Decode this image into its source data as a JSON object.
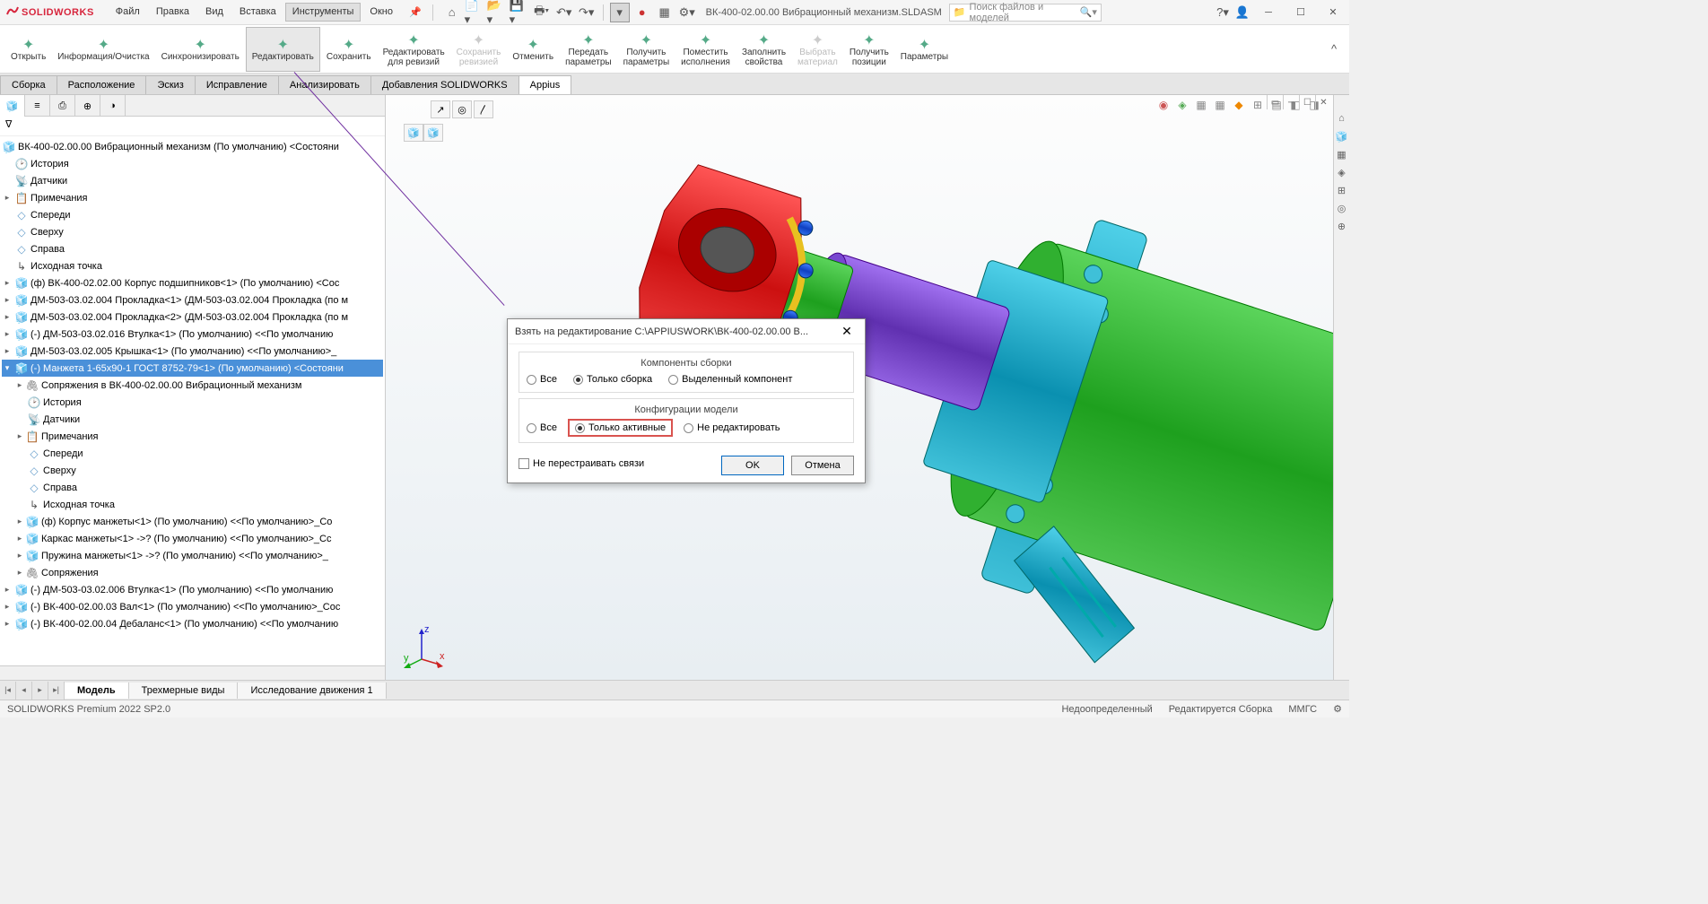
{
  "app": {
    "logo_text": "SOLIDWORKS",
    "doc_title": "ВК-400-02.00.00 Вибрационный механизм.SLDASM",
    "search_placeholder": "Поиск файлов и моделей"
  },
  "menu": {
    "file": "Файл",
    "edit": "Правка",
    "view": "Вид",
    "insert": "Вставка",
    "tools": "Инструменты",
    "window": "Окно"
  },
  "ribbon": {
    "open": "Открыть",
    "info": "Информация/Очистка",
    "sync": "Синхронизировать",
    "editmode": "Редактировать",
    "save": "Сохранить",
    "edit_rev": "Редактировать\nдля ревизий",
    "save_rev": "Сохранить\nревизией",
    "cancel": "Отменить",
    "send_params": "Передать\nпараметры",
    "get_params": "Получить\nпараметры",
    "place_exec": "Поместить\nисполнения",
    "fill_props": "Заполнить\nсвойства",
    "sel_material": "Выбрать\nматериал",
    "get_positions": "Получить\nпозиции",
    "params": "Параметры"
  },
  "tabs": {
    "assembly": "Сборка",
    "layout": "Расположение",
    "sketch": "Эскиз",
    "fix": "Исправление",
    "analyze": "Анализировать",
    "addins": "Добавления SOLIDWORKS",
    "appius": "Appius"
  },
  "tree": {
    "root": "ВК-400-02.00.00 Вибрационный механизм (По умолчанию) <Состояни",
    "history": "История",
    "sensors": "Датчики",
    "notes": "Примечания",
    "front": "Спереди",
    "top": "Сверху",
    "right": "Справа",
    "origin": "Исходная точка",
    "n1": "(ф) ВК-400-02.02.00 Корпус подшипников<1> (По умолчанию) <Сос",
    "n2": "ДМ-503-03.02.004 Прокладка<1> (ДМ-503-03.02.004 Прокладка (по м",
    "n3": "ДМ-503-03.02.004 Прокладка<2> (ДМ-503-03.02.004 Прокладка (по м",
    "n4": "(-) ДМ-503-03.02.016 Втулка<1> (По умолчанию) <<По умолчанию",
    "n5": "ДМ-503-03.02.005 Крышка<1> (По умолчанию) <<По умолчанию>_",
    "n6": "(-) Манжета 1-65х90-1 ГОСТ 8752-79<1> (По умолчанию) <Состояни",
    "n6_mates_in": "Сопряжения в ВК-400-02.00.00 Вибрационный механизм",
    "n6_hist": "История",
    "n6_sens": "Датчики",
    "n6_notes": "Примечания",
    "n6_front": "Спереди",
    "n6_top": "Сверху",
    "n6_right": "Справа",
    "n6_origin": "Исходная точка",
    "n6_c1": "(ф) Корпус манжеты<1> (По умолчанию) <<По умолчанию>_Со",
    "n6_c2": "Каркас манжеты<1> ->? (По умолчанию) <<По умолчанию>_Сс",
    "n6_c3": "Пружина манжеты<1> ->? (По умолчанию) <<По умолчанию>_",
    "n6_mates": "Сопряжения",
    "n7": "(-) ДМ-503-03.02.006 Втулка<1> (По умолчанию) <<По умолчанию",
    "n8": "(-) ВК-400-02.00.03 Вал<1> (По умолчанию) <<По умолчанию>_Сос",
    "n9": "(-) ВК-400-02.00.04 Дебаланс<1> (По умолчанию) <<По умолчанию"
  },
  "dialog": {
    "title": "Взять на редактирование C:\\APPIUSWORK\\ВК-400-02.00.00 В...",
    "group1": "Компоненты сборки",
    "r_all": "Все",
    "r_asm_only": "Только сборка",
    "r_selected": "Выделенный компонент",
    "group2": "Конфигурации модели",
    "r_cfg_all": "Все",
    "r_cfg_active": "Только активные",
    "r_cfg_none": "Не редактировать",
    "chk_norebuild": "Не перестраивать связи",
    "ok": "OK",
    "cancel": "Отмена"
  },
  "bottom_tabs": {
    "model": "Модель",
    "views3d": "Трехмерные виды",
    "motion": "Исследование движения 1"
  },
  "status": {
    "product": "SOLIDWORKS Premium 2022 SP2.0",
    "undef": "Недоопределенный",
    "editing": "Редактируется Сборка",
    "units": "ММГС"
  }
}
